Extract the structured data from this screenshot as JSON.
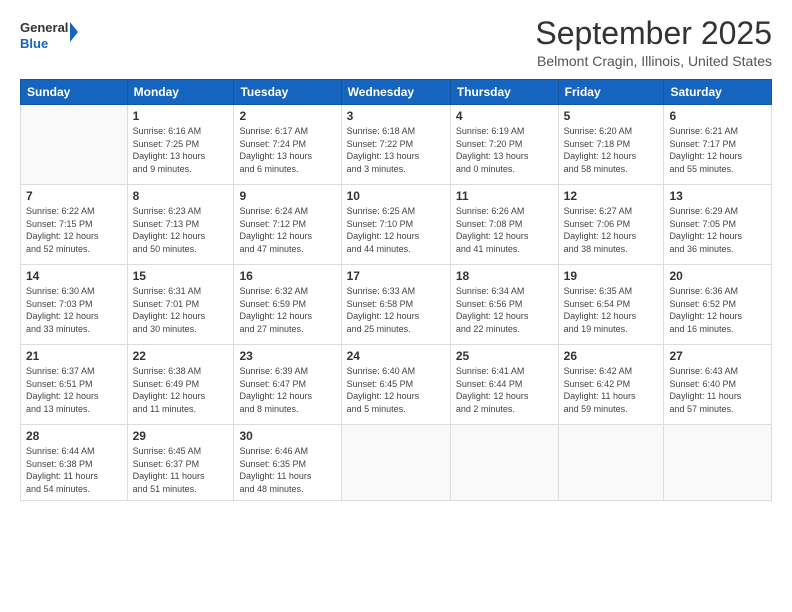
{
  "logo": {
    "general": "General",
    "blue": "Blue"
  },
  "title": "September 2025",
  "subtitle": "Belmont Cragin, Illinois, United States",
  "days_of_week": [
    "Sunday",
    "Monday",
    "Tuesday",
    "Wednesday",
    "Thursday",
    "Friday",
    "Saturday"
  ],
  "weeks": [
    [
      {
        "day": "",
        "info": ""
      },
      {
        "day": "1",
        "info": "Sunrise: 6:16 AM\nSunset: 7:25 PM\nDaylight: 13 hours\nand 9 minutes."
      },
      {
        "day": "2",
        "info": "Sunrise: 6:17 AM\nSunset: 7:24 PM\nDaylight: 13 hours\nand 6 minutes."
      },
      {
        "day": "3",
        "info": "Sunrise: 6:18 AM\nSunset: 7:22 PM\nDaylight: 13 hours\nand 3 minutes."
      },
      {
        "day": "4",
        "info": "Sunrise: 6:19 AM\nSunset: 7:20 PM\nDaylight: 13 hours\nand 0 minutes."
      },
      {
        "day": "5",
        "info": "Sunrise: 6:20 AM\nSunset: 7:18 PM\nDaylight: 12 hours\nand 58 minutes."
      },
      {
        "day": "6",
        "info": "Sunrise: 6:21 AM\nSunset: 7:17 PM\nDaylight: 12 hours\nand 55 minutes."
      }
    ],
    [
      {
        "day": "7",
        "info": "Sunrise: 6:22 AM\nSunset: 7:15 PM\nDaylight: 12 hours\nand 52 minutes."
      },
      {
        "day": "8",
        "info": "Sunrise: 6:23 AM\nSunset: 7:13 PM\nDaylight: 12 hours\nand 50 minutes."
      },
      {
        "day": "9",
        "info": "Sunrise: 6:24 AM\nSunset: 7:12 PM\nDaylight: 12 hours\nand 47 minutes."
      },
      {
        "day": "10",
        "info": "Sunrise: 6:25 AM\nSunset: 7:10 PM\nDaylight: 12 hours\nand 44 minutes."
      },
      {
        "day": "11",
        "info": "Sunrise: 6:26 AM\nSunset: 7:08 PM\nDaylight: 12 hours\nand 41 minutes."
      },
      {
        "day": "12",
        "info": "Sunrise: 6:27 AM\nSunset: 7:06 PM\nDaylight: 12 hours\nand 38 minutes."
      },
      {
        "day": "13",
        "info": "Sunrise: 6:29 AM\nSunset: 7:05 PM\nDaylight: 12 hours\nand 36 minutes."
      }
    ],
    [
      {
        "day": "14",
        "info": "Sunrise: 6:30 AM\nSunset: 7:03 PM\nDaylight: 12 hours\nand 33 minutes."
      },
      {
        "day": "15",
        "info": "Sunrise: 6:31 AM\nSunset: 7:01 PM\nDaylight: 12 hours\nand 30 minutes."
      },
      {
        "day": "16",
        "info": "Sunrise: 6:32 AM\nSunset: 6:59 PM\nDaylight: 12 hours\nand 27 minutes."
      },
      {
        "day": "17",
        "info": "Sunrise: 6:33 AM\nSunset: 6:58 PM\nDaylight: 12 hours\nand 25 minutes."
      },
      {
        "day": "18",
        "info": "Sunrise: 6:34 AM\nSunset: 6:56 PM\nDaylight: 12 hours\nand 22 minutes."
      },
      {
        "day": "19",
        "info": "Sunrise: 6:35 AM\nSunset: 6:54 PM\nDaylight: 12 hours\nand 19 minutes."
      },
      {
        "day": "20",
        "info": "Sunrise: 6:36 AM\nSunset: 6:52 PM\nDaylight: 12 hours\nand 16 minutes."
      }
    ],
    [
      {
        "day": "21",
        "info": "Sunrise: 6:37 AM\nSunset: 6:51 PM\nDaylight: 12 hours\nand 13 minutes."
      },
      {
        "day": "22",
        "info": "Sunrise: 6:38 AM\nSunset: 6:49 PM\nDaylight: 12 hours\nand 11 minutes."
      },
      {
        "day": "23",
        "info": "Sunrise: 6:39 AM\nSunset: 6:47 PM\nDaylight: 12 hours\nand 8 minutes."
      },
      {
        "day": "24",
        "info": "Sunrise: 6:40 AM\nSunset: 6:45 PM\nDaylight: 12 hours\nand 5 minutes."
      },
      {
        "day": "25",
        "info": "Sunrise: 6:41 AM\nSunset: 6:44 PM\nDaylight: 12 hours\nand 2 minutes."
      },
      {
        "day": "26",
        "info": "Sunrise: 6:42 AM\nSunset: 6:42 PM\nDaylight: 11 hours\nand 59 minutes."
      },
      {
        "day": "27",
        "info": "Sunrise: 6:43 AM\nSunset: 6:40 PM\nDaylight: 11 hours\nand 57 minutes."
      }
    ],
    [
      {
        "day": "28",
        "info": "Sunrise: 6:44 AM\nSunset: 6:38 PM\nDaylight: 11 hours\nand 54 minutes."
      },
      {
        "day": "29",
        "info": "Sunrise: 6:45 AM\nSunset: 6:37 PM\nDaylight: 11 hours\nand 51 minutes."
      },
      {
        "day": "30",
        "info": "Sunrise: 6:46 AM\nSunset: 6:35 PM\nDaylight: 11 hours\nand 48 minutes."
      },
      {
        "day": "",
        "info": ""
      },
      {
        "day": "",
        "info": ""
      },
      {
        "day": "",
        "info": ""
      },
      {
        "day": "",
        "info": ""
      }
    ]
  ]
}
